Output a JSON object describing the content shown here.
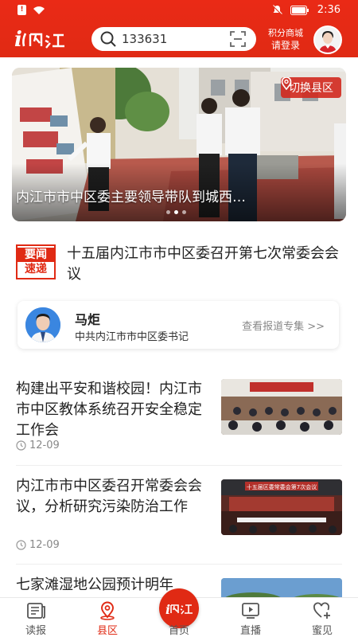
{
  "status_bar": {
    "time": "2:36"
  },
  "header": {
    "logo_text": "i内江",
    "search": {
      "value": "133631"
    },
    "points_label": "积分商城",
    "login_label": "请登录"
  },
  "banner": {
    "switch_label": "切换县区",
    "title": "内江市市中区委主要领导带队到城西…",
    "dots": 3,
    "active_dot": 1
  },
  "flash": {
    "badge_line1": "要闻",
    "badge_line2": "速递",
    "headline": "十五届内江市市中区委召开第七次常委会会议"
  },
  "leader": {
    "name": "马炬",
    "title": "中共内江市市中区委书记",
    "link": "查看报道专集 >>"
  },
  "news": [
    {
      "title": "构建出平安和谐校园！内江市市中区教体系统召开安全稳定工作会",
      "date": "12-09"
    },
    {
      "title": "内江市市中区委召开常委会会议，分析研究污染防治工作",
      "date": "12-09",
      "thumb_text": "十五届区委常委会第7次会议"
    },
    {
      "title": "七家滩湿地公园预计明年"
    }
  ],
  "bottom_nav": [
    {
      "label": "读报",
      "icon": "newspaper-icon"
    },
    {
      "label": "县区",
      "icon": "location-pin-icon",
      "active": true
    },
    {
      "label": "首页",
      "icon": "home-logo-icon"
    },
    {
      "label": "直播",
      "icon": "live-tv-icon"
    },
    {
      "label": "蜜见",
      "icon": "heart-plus-icon"
    }
  ],
  "colors": {
    "brand_red": "#e02a14",
    "active_tab": "#e02a14"
  }
}
